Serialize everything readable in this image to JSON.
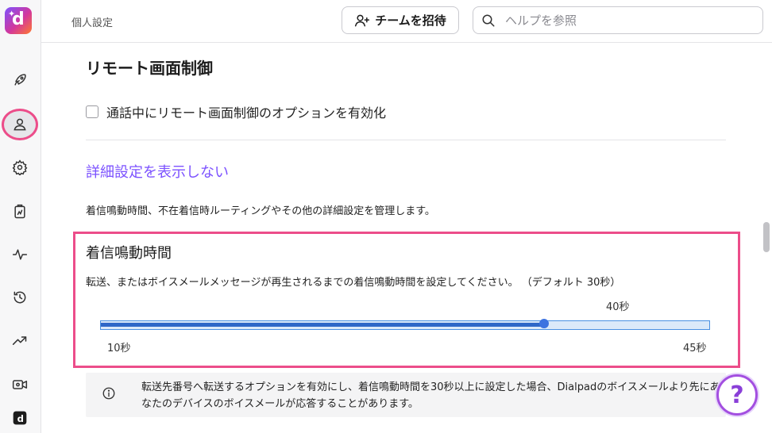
{
  "header": {
    "breadcrumb": "個人設定",
    "invite_label": "チームを招待",
    "search_placeholder": "ヘルプを参照"
  },
  "sidebar": {
    "logo_letter": "d",
    "items": [
      {
        "icon": "rocket-icon"
      },
      {
        "icon": "person-icon",
        "active": true
      },
      {
        "icon": "gear-icon"
      },
      {
        "icon": "clipboard-icon"
      },
      {
        "icon": "activity-icon"
      },
      {
        "icon": "history-icon"
      },
      {
        "icon": "trend-icon"
      },
      {
        "icon": "video-icon"
      },
      {
        "icon": "dialpad-app-icon"
      }
    ]
  },
  "remote_control": {
    "title": "リモート画面制御",
    "checkbox_label": "通話中にリモート画面制御のオプションを有効化",
    "checked": false
  },
  "advanced": {
    "toggle_link": "詳細設定を表示しない",
    "description": "着信鳴動時間、不在着信時ルーティングやその他の詳細設定を管理します。"
  },
  "ring_duration": {
    "title": "着信鳴動時間",
    "description": "転送、またはボイスメールメッセージが再生されるまでの着信鳴動時間を設定してください。 （デフォルト 30秒）",
    "current_label": "40秒",
    "current_value": 40,
    "min_value": 10,
    "max_value": 45,
    "min_label": "10秒",
    "max_label": "45秒"
  },
  "info": {
    "text": "転送先番号へ転送するオプションを有効にし、着信鳴動時間を30秒以上に設定した場合、Dialpadのボイスメールより先にあなたのデバイスのボイスメールが応答することがあります。"
  },
  "help_button": {
    "label": "?"
  },
  "colors": {
    "accent_purple": "#7c52ff",
    "highlight_pink": "#ec4d8a",
    "slider_blue": "#3d73e0"
  }
}
